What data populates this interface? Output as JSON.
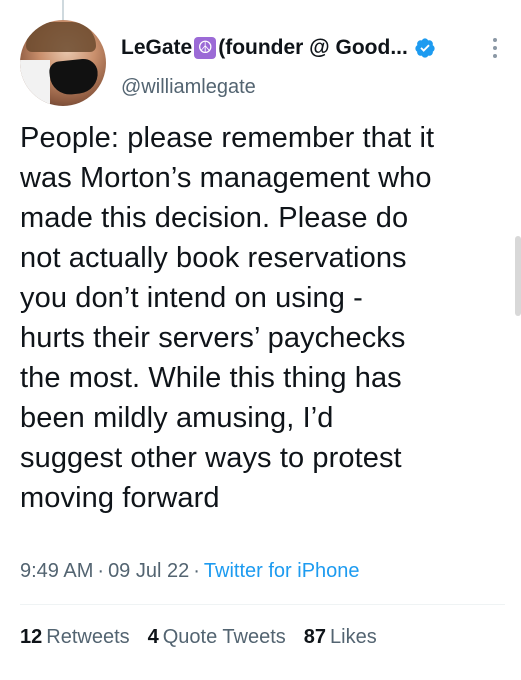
{
  "author": {
    "display_name": "LeGate",
    "name_emoji": "☮",
    "display_name_suffix": "(founder @ Good...",
    "handle": "@williamlegate",
    "verified": true
  },
  "tweet": {
    "text": "People: please remember that it\nwas Morton’s management who\nmade this decision. Please do\nnot actually book reservations\nyou don’t intend on using -\nhurts their servers’ paychecks\nthe most. While this thing has\nbeen mildly amusing, I’d\nsuggest other ways to protest\nmoving forward"
  },
  "meta": {
    "time": "9:49 AM",
    "separator": "·",
    "date": "09 Jul 22",
    "source": "Twitter for iPhone"
  },
  "stats": {
    "retweets_count": "12",
    "retweets_label": "Retweets",
    "quotes_count": "4",
    "quotes_label": "Quote Tweets",
    "likes_count": "87",
    "likes_label": "Likes"
  },
  "colors": {
    "accent": "#1d9bf0",
    "secondary_text": "#536471",
    "primary_text": "#0f1419",
    "peace_badge": "#9b6ad6"
  },
  "icons": {
    "verified": "verified-badge-icon",
    "more": "more-options-icon",
    "peace": "peace-symbol-icon"
  }
}
